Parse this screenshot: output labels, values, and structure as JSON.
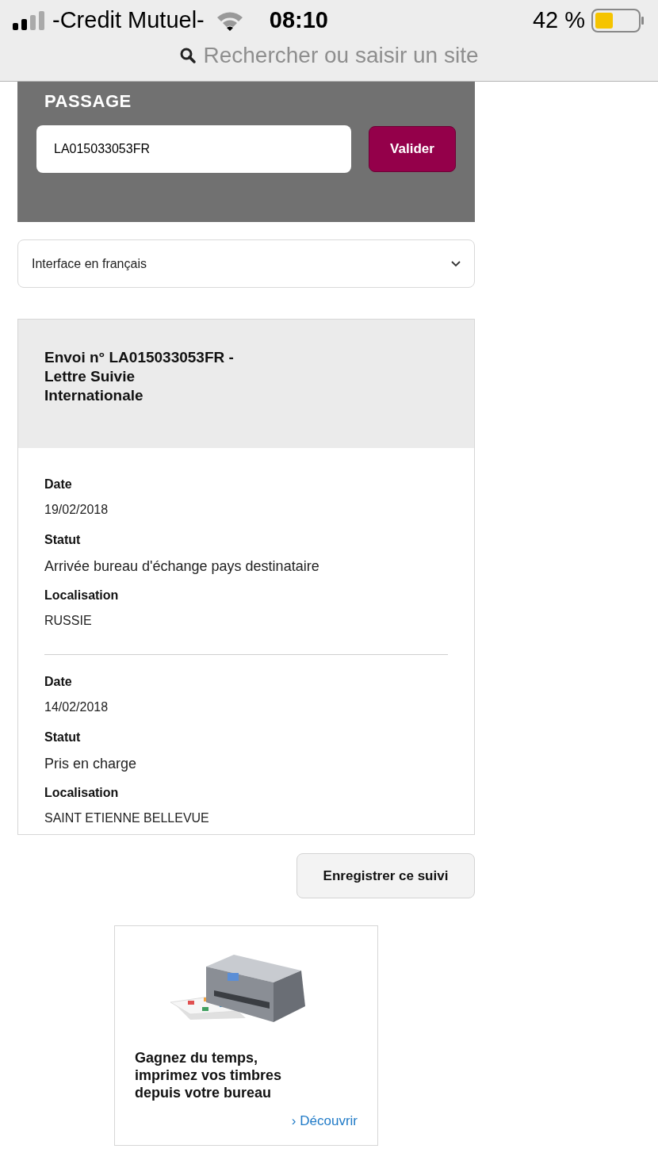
{
  "status_bar": {
    "carrier": "-Credit Mutuel-",
    "time": "08:10",
    "battery": "42 %"
  },
  "address_bar": {
    "placeholder": "Rechercher ou saisir un site"
  },
  "tracking_form": {
    "heading": "PASSAGE",
    "value": "LA015033053FR",
    "button": "Valider"
  },
  "language_select": {
    "value": "Interface en français"
  },
  "shipment": {
    "title": "Envoi n° LA015033053FR -\nLettre Suivie\nInternationale",
    "events": [
      {
        "date_label": "Date",
        "date": "19/02/2018",
        "status_label": "Statut",
        "status": "Arrivée bureau d'échange pays destinataire",
        "location_label": "Localisation",
        "location": "RUSSIE"
      },
      {
        "date_label": "Date",
        "date": "14/02/2018",
        "status_label": "Statut",
        "status": "Pris en charge",
        "location_label": "Localisation",
        "location": "SAINT ETIENNE BELLEVUE"
      }
    ]
  },
  "save_button": "Enregistrer ce suivi",
  "ad": {
    "text": "Gagnez du temps,\nimprimez vos timbres\ndepuis votre bureau",
    "link_arrow": "›",
    "link": "Découvrir"
  }
}
